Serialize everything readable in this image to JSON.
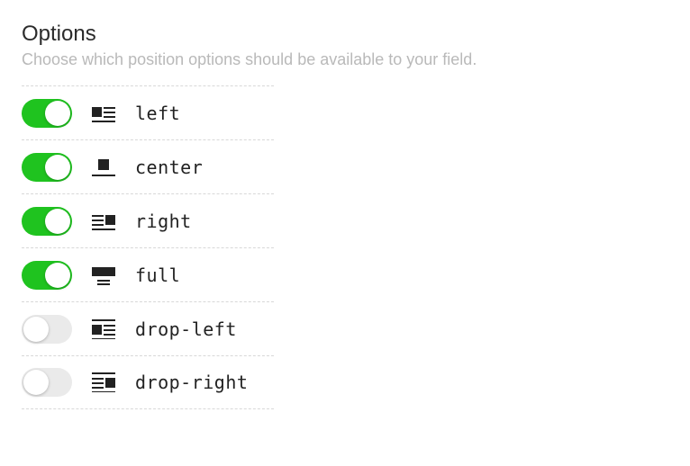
{
  "section": {
    "title": "Options",
    "description": "Choose which position options should be available to your field."
  },
  "options": [
    {
      "key": "left",
      "label": "left",
      "enabled": true,
      "icon": "align-left-icon"
    },
    {
      "key": "center",
      "label": "center",
      "enabled": true,
      "icon": "align-center-icon"
    },
    {
      "key": "right",
      "label": "right",
      "enabled": true,
      "icon": "align-right-icon"
    },
    {
      "key": "full",
      "label": "full",
      "enabled": true,
      "icon": "align-full-icon"
    },
    {
      "key": "drop-left",
      "label": "drop-left",
      "enabled": false,
      "icon": "align-drop-left-icon"
    },
    {
      "key": "drop-right",
      "label": "drop-right",
      "enabled": false,
      "icon": "align-drop-right-icon"
    }
  ]
}
